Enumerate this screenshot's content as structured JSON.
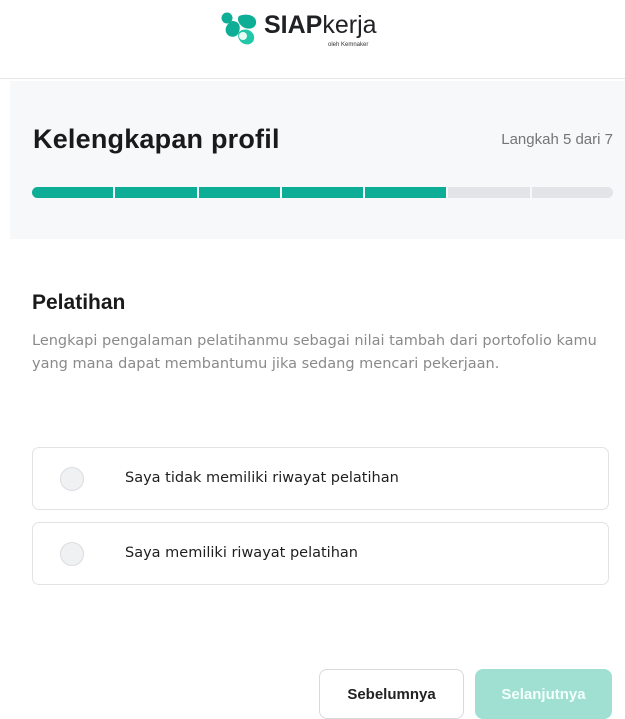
{
  "brand": {
    "name_bold": "SIAP",
    "name_thin": "kerja",
    "subtitle": "oleh Kemnaker",
    "mark_icon": "siapkerja-logo-icon",
    "colors": {
      "primary": "#0ead96",
      "secondary": "#22c7a8"
    }
  },
  "progress": {
    "title": "Kelengkapan profil",
    "step_text": "Langkah 5 dari 7",
    "current_step": 5,
    "total_steps": 7,
    "active_color": "#0ead96",
    "inactive_color": "#e3e4e8"
  },
  "section": {
    "title": "Pelatihan",
    "description": "Lengkapi pengalaman pelatihanmu sebagai nilai tambah dari portofolio kamu yang mana dapat membantumu jika sedang mencari pekerjaan."
  },
  "options": [
    {
      "label": "Saya tidak memiliki riwayat pelatihan",
      "selected": false
    },
    {
      "label": "Saya memiliki riwayat pelatihan",
      "selected": false
    }
  ],
  "buttons": {
    "previous": "Sebelumnya",
    "next": "Selanjutnya",
    "next_disabled_color": "#9fe0d3"
  }
}
